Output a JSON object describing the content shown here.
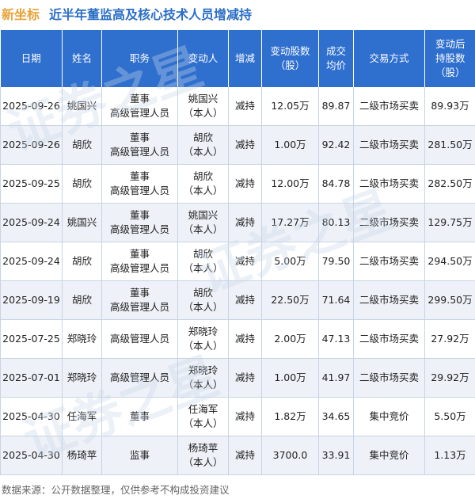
{
  "header": {
    "brand": "新坐标",
    "title": "近半年董监高及核心技术人员增减持"
  },
  "table": {
    "columns": [
      "日期",
      "姓名",
      "职务",
      "变动人",
      "增减",
      "变动股数\n（股）",
      "成交\n均价",
      "交易方式",
      "变动后\n持股数\n（股）"
    ],
    "rows": [
      {
        "date": "2025-09-26",
        "name": "姚国兴",
        "position": "董事\n高级管理人员",
        "changer": "姚国兴\n（本人）",
        "direction": "减持",
        "shares": "12.05万",
        "price": "89.87",
        "method": "二级市场买卖",
        "after": "89.93万"
      },
      {
        "date": "2025-09-26",
        "name": "胡欣",
        "position": "董事\n高级管理人员",
        "changer": "胡欣\n（本人）",
        "direction": "减持",
        "shares": "1.00万",
        "price": "92.42",
        "method": "二级市场买卖",
        "after": "281.50万"
      },
      {
        "date": "2025-09-25",
        "name": "胡欣",
        "position": "董事\n高级管理人员",
        "changer": "胡欣\n（本人）",
        "direction": "减持",
        "shares": "12.00万",
        "price": "84.78",
        "method": "二级市场买卖",
        "after": "282.50万"
      },
      {
        "date": "2025-09-24",
        "name": "姚国兴",
        "position": "董事\n高级管理人员",
        "changer": "姚国兴\n（本人）",
        "direction": "减持",
        "shares": "17.27万",
        "price": "80.13",
        "method": "二级市场买卖",
        "after": "129.75万"
      },
      {
        "date": "2025-09-24",
        "name": "胡欣",
        "position": "董事\n高级管理人员",
        "changer": "胡欣\n（本人）",
        "direction": "减持",
        "shares": "5.00万",
        "price": "79.50",
        "method": "二级市场买卖",
        "after": "294.50万"
      },
      {
        "date": "2025-09-19",
        "name": "胡欣",
        "position": "董事\n高级管理人员",
        "changer": "胡欣\n（本人）",
        "direction": "减持",
        "shares": "22.50万",
        "price": "71.64",
        "method": "二级市场买卖",
        "after": "299.50万"
      },
      {
        "date": "2025-07-25",
        "name": "郑晓玲",
        "position": "高级管理人员",
        "changer": "郑晓玲\n（本人）",
        "direction": "减持",
        "shares": "2.00万",
        "price": "47.13",
        "method": "二级市场买卖",
        "after": "27.92万"
      },
      {
        "date": "2025-07-01",
        "name": "郑晓玲",
        "position": "高级管理人员",
        "changer": "郑晓玲\n（本人）",
        "direction": "减持",
        "shares": "1.00万",
        "price": "41.97",
        "method": "二级市场买卖",
        "after": "29.92万"
      },
      {
        "date": "2025-04-30",
        "name": "任海军",
        "position": "董事",
        "changer": "任海军\n（本人）",
        "direction": "减持",
        "shares": "1.82万",
        "price": "34.65",
        "method": "集中竞价",
        "after": "5.50万"
      },
      {
        "date": "2025-04-30",
        "name": "杨琦苹",
        "position": "监事",
        "changer": "杨琦苹\n（本人）",
        "direction": "减持",
        "shares": "3700.0",
        "price": "33.91",
        "method": "集中竞价",
        "after": "1.13万"
      }
    ]
  },
  "watermark": {
    "text": "证券之星"
  },
  "footer": {
    "source": "数据来源：公开数据整理，仅供参考不构成投资建议"
  },
  "colors": {
    "header_bg": "#2f6fce",
    "brand": "#e8a33a",
    "title": "#2b6fc6",
    "decrease": "#2a9d3a",
    "stripe": "#eef2f8"
  }
}
